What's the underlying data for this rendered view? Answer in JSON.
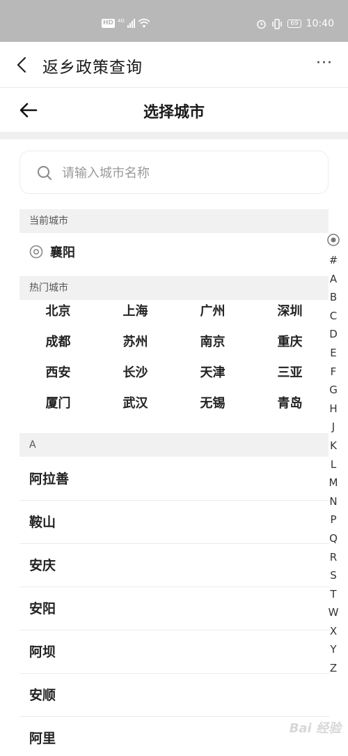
{
  "status_bar": {
    "network": "HD",
    "signal_label": "4G",
    "battery": "69",
    "time": "10:40"
  },
  "app_header": {
    "title": "返乡政策查询",
    "more": "···"
  },
  "page_header": {
    "title": "选择城市"
  },
  "search": {
    "placeholder": "请输入城市名称"
  },
  "current_city": {
    "header": "当前城市",
    "name": "襄阳"
  },
  "hot_cities": {
    "header": "热门城市",
    "items": [
      "北京",
      "上海",
      "广州",
      "深圳",
      "成都",
      "苏州",
      "南京",
      "重庆",
      "西安",
      "长沙",
      "天津",
      "三亚",
      "厦门",
      "武汉",
      "无锡",
      "青岛"
    ]
  },
  "city_list": {
    "section_letter": "A",
    "items": [
      "阿拉善",
      "鞍山",
      "安庆",
      "安阳",
      "阿坝",
      "安顺",
      "阿里"
    ]
  },
  "index_bar": {
    "letters": [
      "#",
      "A",
      "B",
      "C",
      "D",
      "E",
      "F",
      "G",
      "H",
      "J",
      "K",
      "L",
      "M",
      "N",
      "P",
      "Q",
      "R",
      "S",
      "T",
      "W",
      "X",
      "Y",
      "Z"
    ]
  },
  "watermark": "Bai 经验"
}
